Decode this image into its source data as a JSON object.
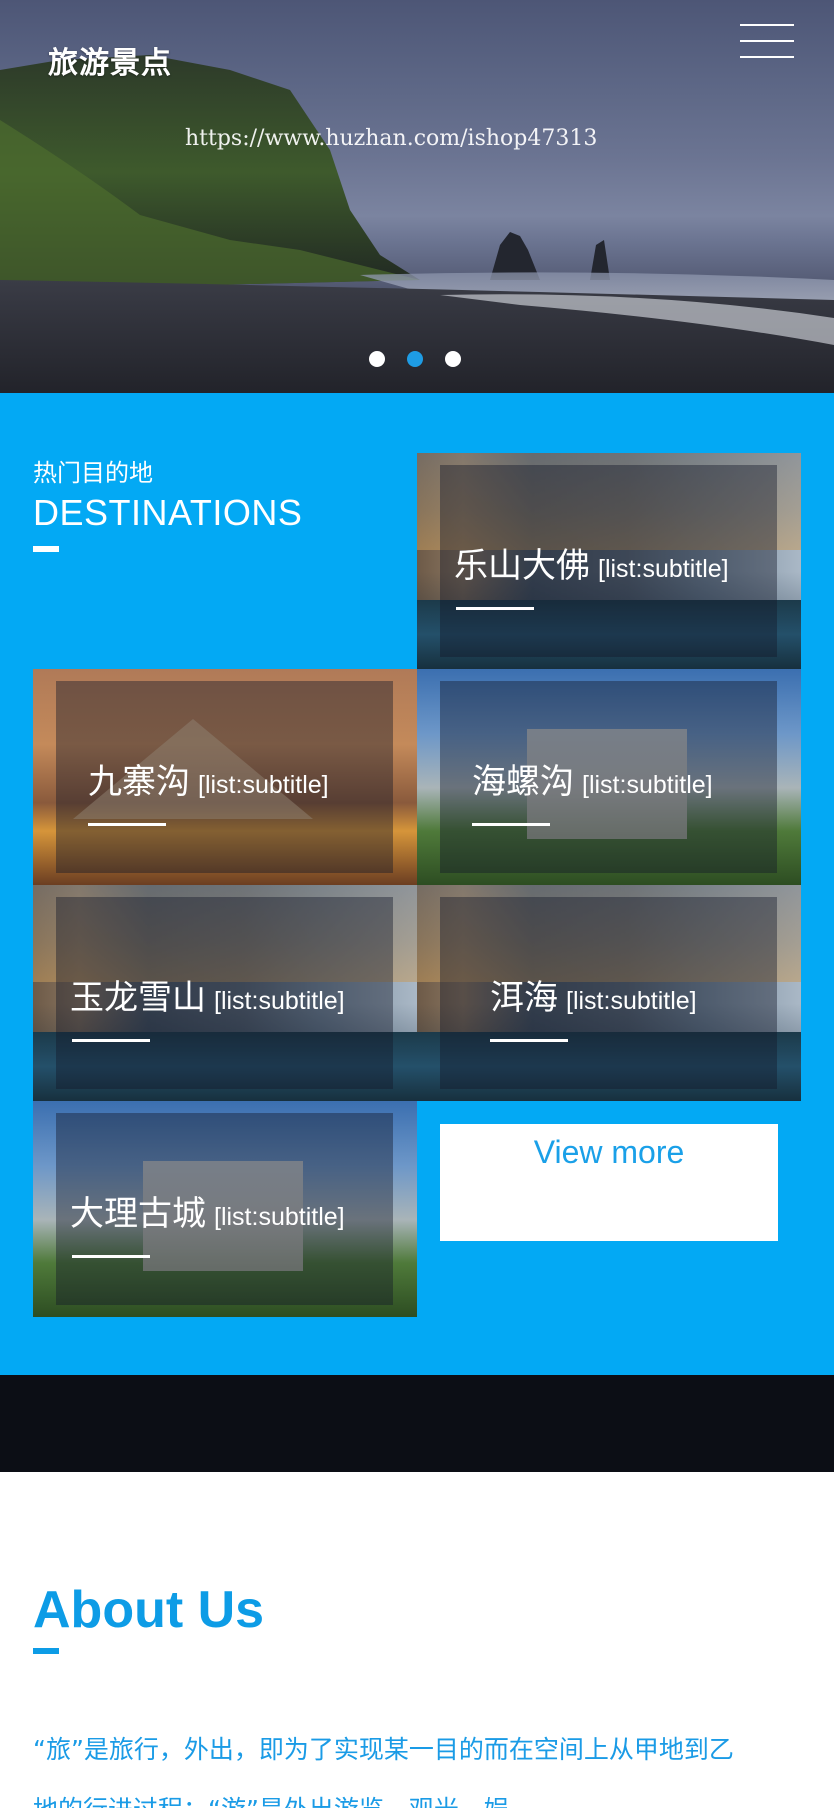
{
  "header": {
    "logo": "旅游景点",
    "menu_icon": "hamburger-menu-icon",
    "watermark": "https://www.huzhan.com/ishop47313",
    "carousel": {
      "slides": 3,
      "active_index": 1
    }
  },
  "destinations": {
    "title_cn": "热门目的地",
    "title_en": "DESTINATIONS",
    "items": [
      {
        "title": "乐山大佛",
        "subtitle": "[list:subtitle]",
        "image": "venice-canal"
      },
      {
        "title": "九寨沟",
        "subtitle": "[list:subtitle]",
        "image": "louvre-pyramid"
      },
      {
        "title": "海螺沟",
        "subtitle": "[list:subtitle]",
        "image": "castle"
      },
      {
        "title": "玉龙雪山",
        "subtitle": "[list:subtitle]",
        "image": "venice-canal"
      },
      {
        "title": "洱海",
        "subtitle": "[list:subtitle]",
        "image": "venice-canal"
      },
      {
        "title": "大理古城",
        "subtitle": "[list:subtitle]",
        "image": "castle"
      }
    ],
    "view_more": "View more"
  },
  "about": {
    "title": "About Us",
    "text": "“旅”是旅行，外出，即为了实现某一目的而在空间上从甲地到乙地的行进过程；“游”是外出游览、观光、娱"
  },
  "colors": {
    "accent": "#03a9f4",
    "text_blue": "#0d9ce6",
    "strip": "#0c0e15"
  }
}
